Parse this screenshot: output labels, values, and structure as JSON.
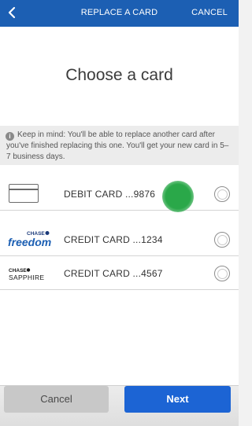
{
  "header": {
    "title": "REPLACE A CARD",
    "cancel_label": "CANCEL"
  },
  "main": {
    "title": "Choose a card",
    "notice": "Keep in mind: You'll be able to replace another card after you've finished replacing this one. You'll get your new card in 5–7 business days."
  },
  "cards": [
    {
      "label": "DEBIT CARD ...9876",
      "logo": "generic-card-icon",
      "selected": false
    },
    {
      "label": "CREDIT CARD ...1234",
      "logo": "Chase freedom",
      "selected": false
    },
    {
      "label": "CREDIT CARD ...4567",
      "logo": "Chase Sapphire",
      "selected": false
    }
  ],
  "logos": {
    "freedom_top": "CHASE",
    "freedom_main": "freedom",
    "sapphire_top": "CHASE",
    "sapphire_main": "SAPPHIRE"
  },
  "footer": {
    "cancel_label": "Cancel",
    "next_label": "Next"
  },
  "colors": {
    "brand_blue": "#1c5fb3",
    "next_button": "#1c64d4",
    "touch_indicator": "#2aa849"
  }
}
